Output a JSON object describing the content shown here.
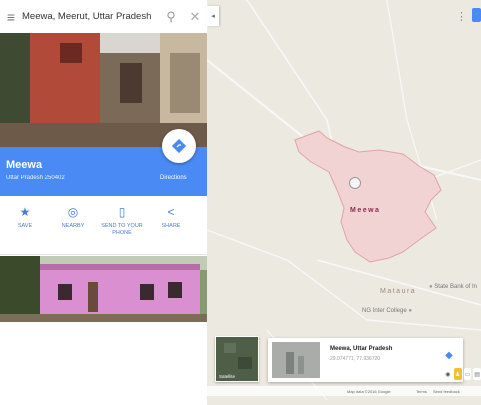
{
  "search": {
    "query": "Meewa, Meerut, Uttar Pradesh"
  },
  "place": {
    "name": "Meewa",
    "subtitle": "Uttar Pradesh 250402",
    "directions_label": "Directions"
  },
  "actions": [
    {
      "label": "SAVE",
      "icon": "star-icon"
    },
    {
      "label": "NEARBY",
      "icon": "nearby-icon"
    },
    {
      "label": "SEND TO YOUR PHONE",
      "icon": "phone-icon"
    },
    {
      "label": "SHARE",
      "icon": "share-icon"
    }
  ],
  "map": {
    "area_label": "Meewa",
    "nearby_label": "Mataura",
    "pois": [
      {
        "label": "State Bank of In"
      },
      {
        "label": "NG Inter College"
      }
    ]
  },
  "bottom": {
    "satellite_label": "Satellite",
    "card_title": "Meewa, Uttar Pradesh",
    "card_coords": "29.074771, 77.936720"
  },
  "footer": {
    "map_data": "Map data ©2016 Google",
    "terms": "Terms",
    "feedback": "Send feedback"
  },
  "colors": {
    "accent": "#4a8af4",
    "area_fill": "#f2d3d3",
    "area_border": "#e0a3a3"
  }
}
